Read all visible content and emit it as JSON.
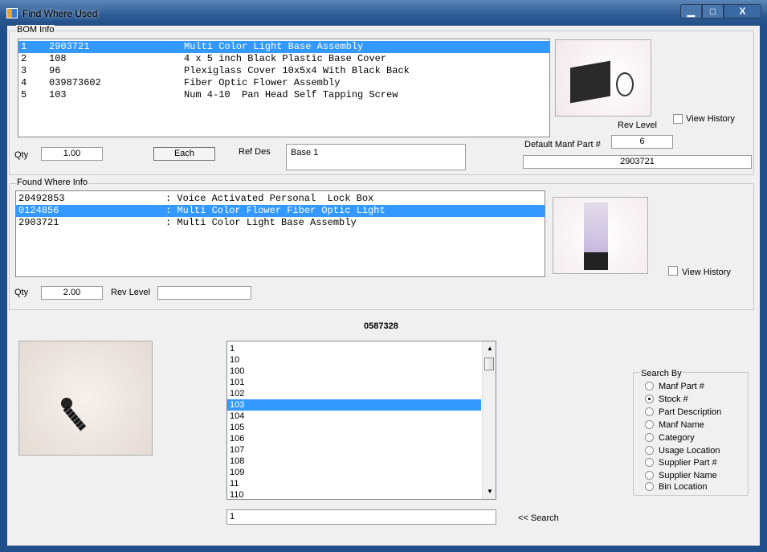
{
  "window": {
    "title": "Find Where Used",
    "minimize": "▁",
    "maximize": "□",
    "close": "X"
  },
  "bom": {
    "group_label": "BOM Info",
    "rows": [
      {
        "n": "1",
        "stock": "2903721",
        "desc": "Multi Color Light Base Assembly",
        "selected": true
      },
      {
        "n": "2",
        "stock": "108",
        "desc": "4 x 5 inch Black Plastic Base Cover"
      },
      {
        "n": "3",
        "stock": "96",
        "desc": "Plexiglass Cover 10x5x4 With Black Back"
      },
      {
        "n": "4",
        "stock": "039873602",
        "desc": "Fiber Optic Flower Assembly"
      },
      {
        "n": "5",
        "stock": "103",
        "desc": "Num 4-10  Pan Head Self Tapping Screw"
      }
    ],
    "qty_label": "Qty",
    "qty": "1.00",
    "unit": "Each",
    "refdes_label": "Ref Des",
    "refdes": "Base 1",
    "view_history": "View History",
    "rev_label": "Rev Level",
    "rev": "6",
    "manf_label": "Default Manf Part #",
    "manf": "2903721"
  },
  "found": {
    "group_label": "Found Where Info",
    "rows": [
      {
        "stock": "20492853",
        "desc": ": Voice Activated Personal  Lock Box"
      },
      {
        "stock": "0124856",
        "desc": ": Multi Color Flower Fiber Optic Light",
        "selected": true
      },
      {
        "stock": "2903721",
        "desc": ": Multi Color Light Base Assembly"
      }
    ],
    "qty_label": "Qty",
    "qty": "2.00",
    "rev_label": "Rev Level",
    "rev": "",
    "view_history": "View History"
  },
  "part": {
    "number": "0587328"
  },
  "search": {
    "items": [
      "1",
      "10",
      "100",
      "101",
      "102",
      "103",
      "104",
      "105",
      "106",
      "107",
      "108",
      "109",
      "11",
      "110"
    ],
    "selected": "103",
    "input": "1",
    "button": "<< Search",
    "group_label": "Search By",
    "options": [
      "Manf Part #",
      "Stock #",
      "Part Description",
      "Manf Name",
      "Category",
      "Usage Location",
      "Supplier Part #",
      "Supplier Name",
      "Bin Location"
    ],
    "selected_option": "Stock #"
  },
  "colors": {
    "selection": "#3399ff",
    "titlebar": "#2c5a93",
    "close": "#c94b3c"
  }
}
